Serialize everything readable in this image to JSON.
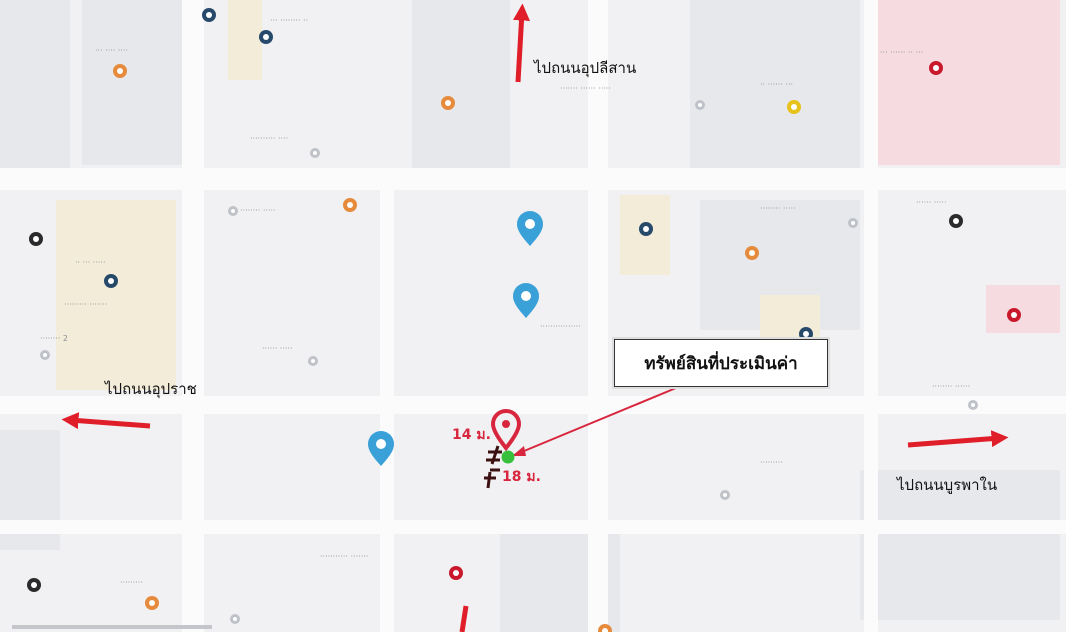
{
  "map": {
    "callout_label": "ทรัพย์สินที่ประเมินค่า",
    "directions": {
      "north": "ไปถนนอุปลีสาน",
      "west": "ไปถนนอุปราช",
      "east": "ไปถนนบูรพาใน"
    },
    "distances": {
      "first": "14 ม.",
      "second": "18 ม."
    },
    "colors": {
      "arrow": "#e01e2a",
      "marker": "#d7263d",
      "pin_blue": "#3aa0d8",
      "subject_dot": "#38c03c"
    },
    "icons": [
      "restaurant-icon",
      "hotel-icon",
      "hospital-icon",
      "info-pin-icon",
      "location-marker-icon",
      "subject-point-icon",
      "gas-station-icon",
      "star-icon"
    ]
  }
}
